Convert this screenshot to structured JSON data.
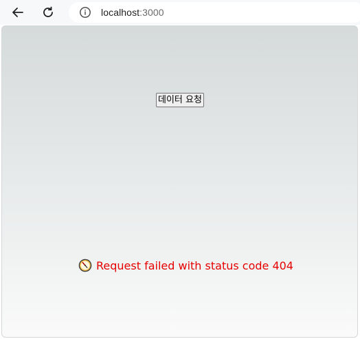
{
  "browser": {
    "url_host": "localhost",
    "url_port": ":3000",
    "icons": {
      "back": "back-arrow-icon",
      "reload": "reload-icon",
      "site_info": "info-icon"
    }
  },
  "page": {
    "request_button_label": "데이터 요청",
    "error_icon": "clock-icon",
    "error_message": "Request failed with status code 404",
    "colors": {
      "error": "#e60000",
      "background_top": "#d5dada",
      "background_bottom": "#fafafa"
    }
  }
}
